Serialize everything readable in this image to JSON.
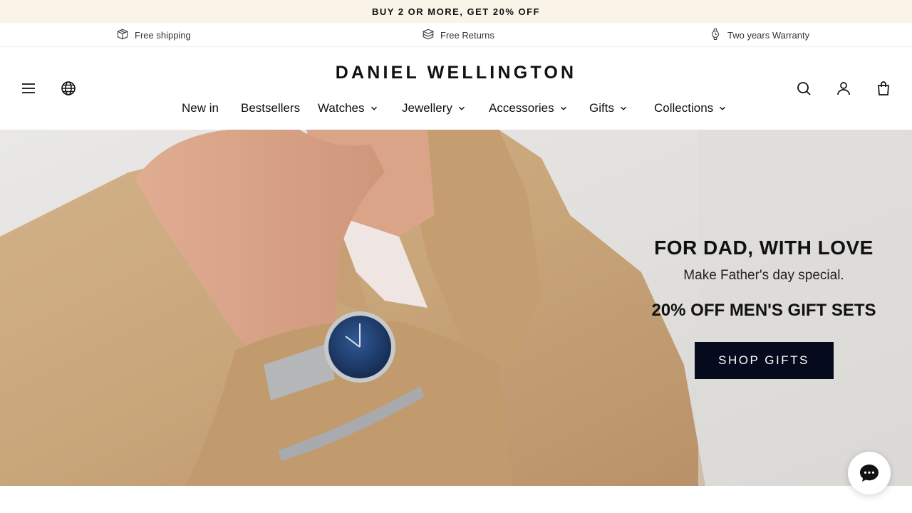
{
  "promo": {
    "text": "BUY 2 OR MORE, GET 20% OFF"
  },
  "usps": [
    {
      "icon": "box-icon",
      "label": "Free shipping"
    },
    {
      "icon": "return-box-icon",
      "label": "Free Returns"
    },
    {
      "icon": "watch-icon",
      "label": "Two years Warranty"
    }
  ],
  "header": {
    "logo": "DANIEL WELLINGTON",
    "left_icons": [
      "menu-icon",
      "globe-icon"
    ],
    "right_icons": [
      "search-icon",
      "account-icon",
      "bag-icon"
    ]
  },
  "nav": [
    {
      "label": "New in",
      "has_dropdown": false
    },
    {
      "label": "Bestsellers",
      "has_dropdown": false
    },
    {
      "label": "Watches",
      "has_dropdown": true
    },
    {
      "label": "Jewellery",
      "has_dropdown": true
    },
    {
      "label": "Accessories",
      "has_dropdown": true
    },
    {
      "label": "Gifts",
      "has_dropdown": true
    },
    {
      "label": "Collections",
      "has_dropdown": true
    }
  ],
  "hero": {
    "title": "FOR DAD, WITH LOVE",
    "subtitle": "Make Father's day special.",
    "offer": "20% OFF MEN'S GIFT SETS",
    "cta": "SHOP GIFTS"
  },
  "chat": {
    "icon": "chat-icon"
  },
  "colors": {
    "promo_bg": "#faf3e8",
    "cta_bg": "#050b1c",
    "jacket": "#c9a57a",
    "watch_dial": "#1f3f72"
  }
}
